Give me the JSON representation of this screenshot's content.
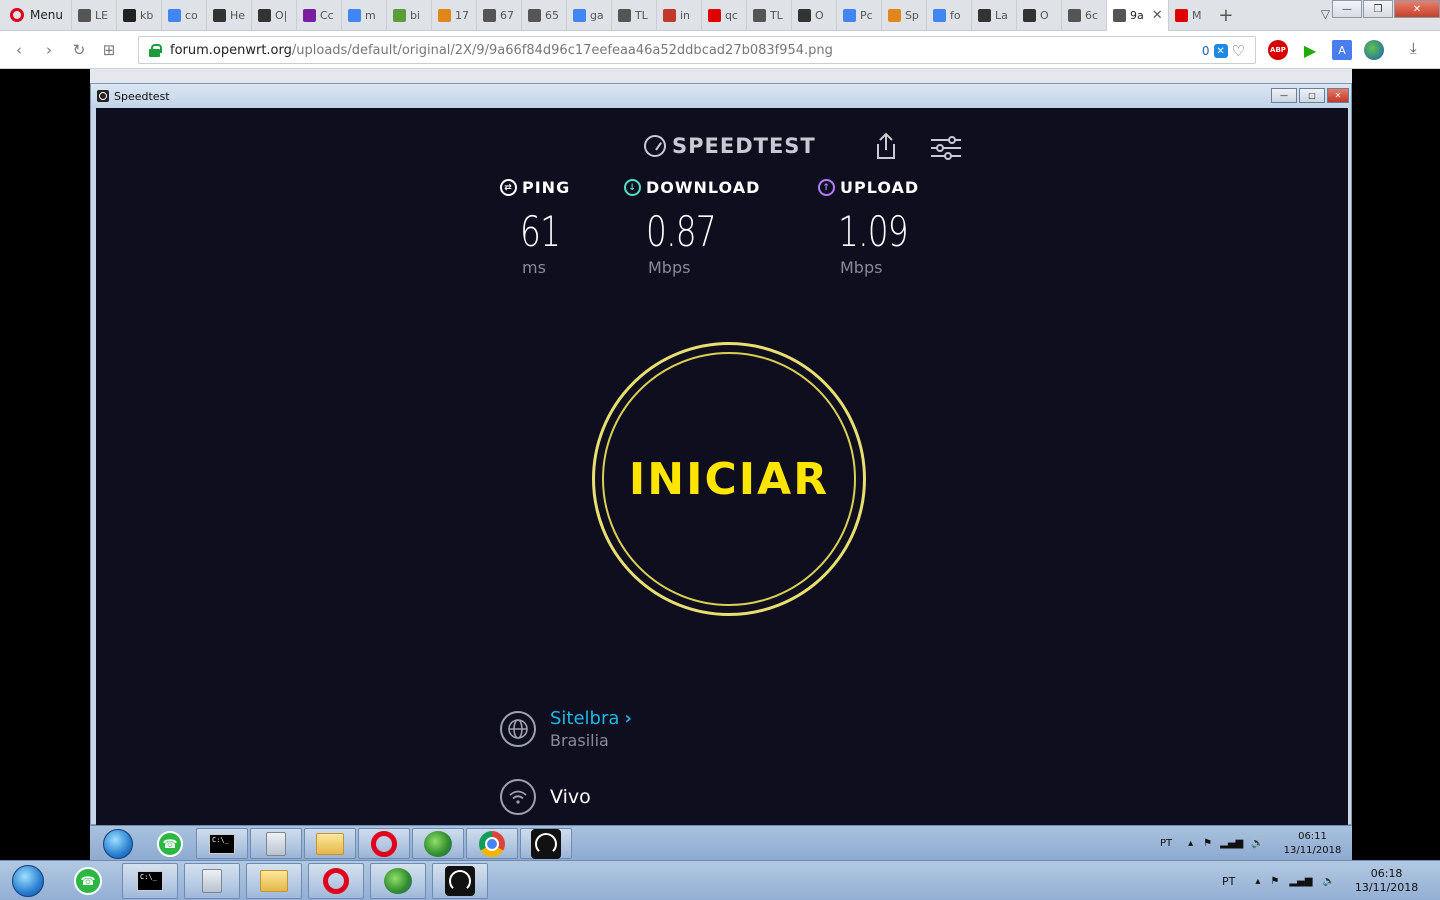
{
  "browser": {
    "menu_label": "Menu",
    "tabs": [
      {
        "label": "LE",
        "icon": "page-icon",
        "color": "#555555"
      },
      {
        "label": "kb",
        "icon": "bug-icon",
        "color": "#222222"
      },
      {
        "label": "co",
        "icon": "google-icon",
        "color": "#4285f4"
      },
      {
        "label": "He",
        "icon": "openwrt-icon",
        "color": "#333333"
      },
      {
        "label": "O|",
        "icon": "app-icon",
        "color": "#333333"
      },
      {
        "label": "Cc",
        "icon": "pc-icon",
        "color": "#7b1fa2"
      },
      {
        "label": "m",
        "icon": "google-icon",
        "color": "#4285f4"
      },
      {
        "label": "bi",
        "icon": "plant-icon",
        "color": "#5a9e3a"
      },
      {
        "label": "17",
        "icon": "map-icon",
        "color": "#e0861b"
      },
      {
        "label": "67",
        "icon": "page-icon",
        "color": "#555555"
      },
      {
        "label": "65",
        "icon": "page-icon",
        "color": "#555555"
      },
      {
        "label": "ga",
        "icon": "google-icon",
        "color": "#4285f4"
      },
      {
        "label": "TL",
        "icon": "page-icon",
        "color": "#555555"
      },
      {
        "label": "in",
        "icon": "edit-icon",
        "color": "#c0392b"
      },
      {
        "label": "qc",
        "icon": "youtube-icon",
        "color": "#e00000"
      },
      {
        "label": "TL",
        "icon": "page-icon",
        "color": "#555555"
      },
      {
        "label": "O",
        "icon": "openwrt-icon",
        "color": "#333333"
      },
      {
        "label": "Pc",
        "icon": "google-icon",
        "color": "#4285f4"
      },
      {
        "label": "Sp",
        "icon": "map-icon",
        "color": "#e0861b"
      },
      {
        "label": "fo",
        "icon": "google-icon",
        "color": "#4285f4"
      },
      {
        "label": "La",
        "icon": "openwrt-icon",
        "color": "#333333"
      },
      {
        "label": "O",
        "icon": "openwrt-icon",
        "color": "#333333"
      },
      {
        "label": "6c",
        "icon": "page-icon",
        "color": "#555555"
      },
      {
        "label": "9a",
        "icon": "page-icon",
        "color": "#555555",
        "active": true
      },
      {
        "label": "M",
        "icon": "youtube-icon",
        "color": "#e00000"
      }
    ],
    "url_host": "forum.openwrt.org",
    "url_path": "/uploads/default/original/2X/9/9a66f84d96c17eefeaa46a52ddbcad27b083f954.png",
    "url_badge_count": "0",
    "abp_label": "ABP",
    "translate_label": "A"
  },
  "speedtest": {
    "window_title": "Speedtest",
    "brand": "SPEEDTEST",
    "metrics": {
      "ping": {
        "label": "PING",
        "value": "61",
        "unit": "ms",
        "color": "#ffffff"
      },
      "download": {
        "label": "DOWNLOAD",
        "value": "0.87",
        "unit": "Mbps",
        "color": "#4fe0c6"
      },
      "upload": {
        "label": "UPLOAD",
        "value": "1.09",
        "unit": "Mbps",
        "color": "#b47cff"
      }
    },
    "go_label": "INICIAR",
    "server_name": "Sitelbra",
    "server_location": "Brasilia",
    "isp": "Vivo",
    "accent_yellow": "#ffe500",
    "link_blue": "#1fb6e6"
  },
  "inner_taskbar": {
    "lang": "PT",
    "time": "06:11",
    "date": "13/11/2018"
  },
  "outer_taskbar": {
    "lang": "PT",
    "time": "06:18",
    "date": "13/11/2018"
  }
}
